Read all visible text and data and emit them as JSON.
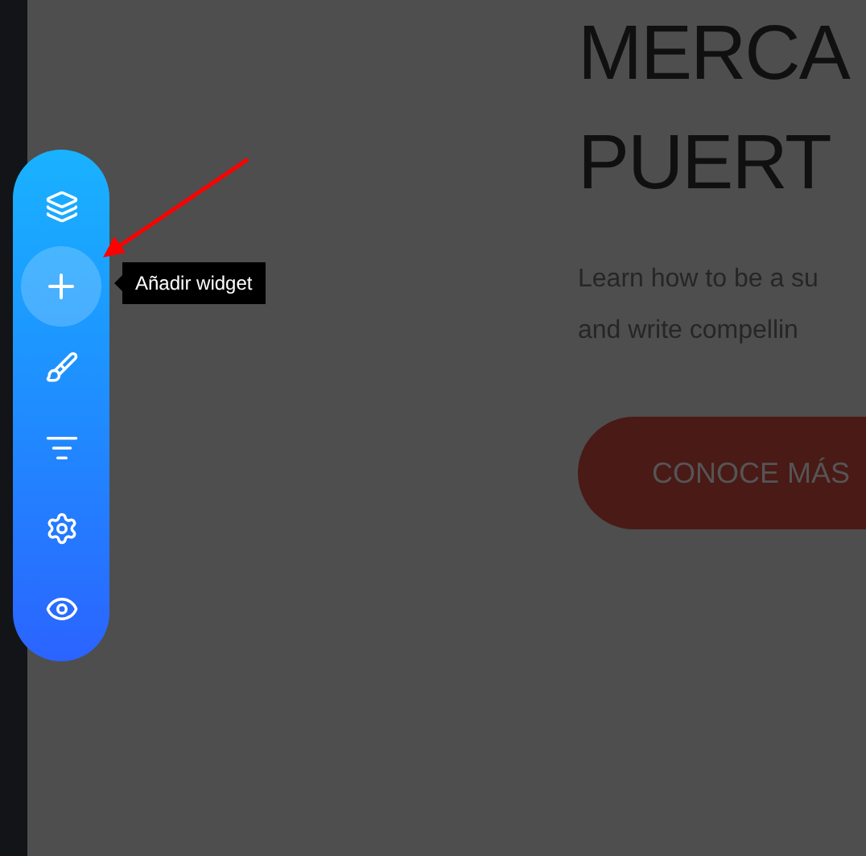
{
  "toolbar": {
    "items": [
      {
        "selected": false
      },
      {
        "selected": true
      },
      {
        "selected": false
      },
      {
        "selected": false
      },
      {
        "selected": false
      },
      {
        "selected": false
      }
    ]
  },
  "tooltip": {
    "text": "Añadir widget"
  },
  "hero": {
    "heading_lines": [
      "MERCA",
      "PUERT"
    ],
    "subtitle_lines": [
      "Learn how to be a su",
      "and write compellin"
    ],
    "button": "CONOCE MÁS"
  }
}
